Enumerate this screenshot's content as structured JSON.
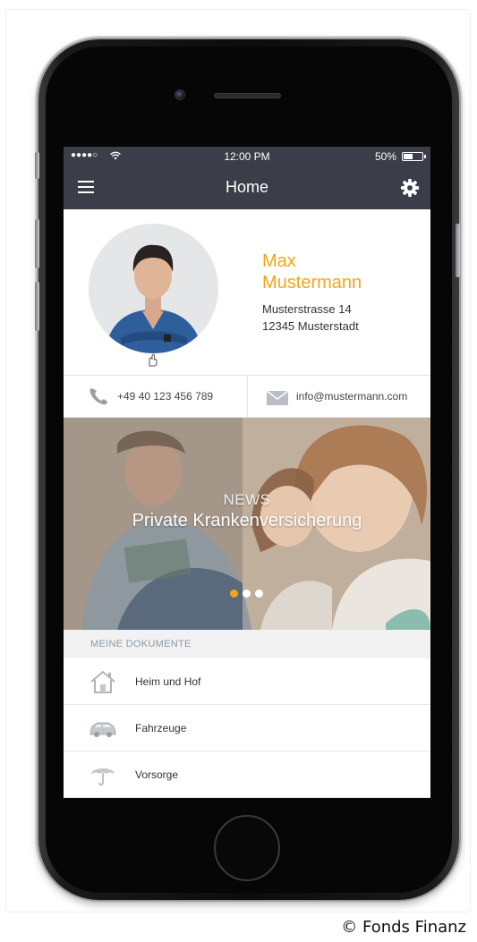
{
  "status_bar": {
    "signal": "●●●●○",
    "time": "12:00 PM",
    "battery_percent": "50%",
    "battery_level": 0.5
  },
  "nav": {
    "title": "Home"
  },
  "profile": {
    "name_line1": "Max",
    "name_line2": "Mustermann",
    "street": "Musterstrasse 14",
    "city": "12345 Musterstadt"
  },
  "contact": {
    "phone": "+49 40 123 456 789",
    "email": "info@mustermann.com"
  },
  "hero": {
    "kicker": "NEWS",
    "title": "Private Krankenversicherung",
    "active_slide": 1,
    "slide_count": 3
  },
  "documents": {
    "header": "MEINE DOKUMENTE",
    "items": [
      {
        "label": "Heim und Hof",
        "icon": "house-icon"
      },
      {
        "label": "Fahrzeuge",
        "icon": "car-icon"
      },
      {
        "label": "Vorsorge",
        "icon": "umbrella-icon"
      }
    ]
  },
  "copyright": "© Fonds Finanz",
  "colors": {
    "bar": "#3b3d48",
    "accent": "#f3a51a",
    "dot_inactive": "#ffffff"
  }
}
